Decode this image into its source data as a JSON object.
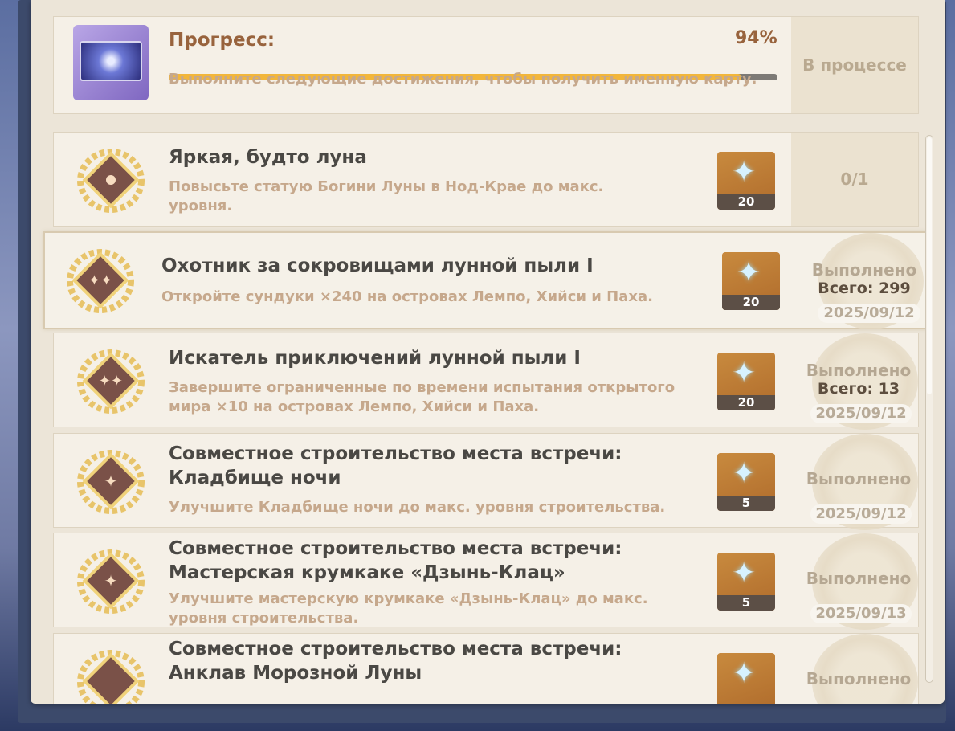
{
  "progress": {
    "title": "Прогресс:",
    "percent_text": "94%",
    "percent": 0.94,
    "description": "Выполните следующие достижения, чтобы получить именную карту.",
    "status": "В процессе"
  },
  "achievements": [
    {
      "title": "Яркая, будто луна",
      "description": "Повысьте статую Богини Луны в Нод-Крае до макс. уровня.",
      "reward": "20",
      "count": "0/1"
    },
    {
      "title": "Охотник за сокровищами лунной пыли I",
      "description": "Откройте сундуки ×240 на островах Лемпо, Хийси и Паха.",
      "reward": "20",
      "status": "Выполнено",
      "total": "Всего: 299",
      "date": "2025/09/12"
    },
    {
      "title": "Искатель приключений лунной пыли I",
      "description": "Завершите ограниченные по времени испытания открытого мира ×10 на островах Лемпо, Хийси и Паха.",
      "reward": "20",
      "status": "Выполнено",
      "total": "Всего: 13",
      "date": "2025/09/12"
    },
    {
      "title": "Совместное строительство места встречи: Кладбище ночи",
      "description": "Улучшите Кладбище ночи до макс. уровня строительства.",
      "reward": "5",
      "status": "Выполнено",
      "date": "2025/09/12"
    },
    {
      "title": "Совместное строительство места встречи: Мастерская крумкаке «Дзынь-Клац»",
      "description": "Улучшите мастерскую крумкаке «Дзынь-Клац» до макс. уровня строительства.",
      "reward": "5",
      "status": "Выполнено",
      "date": "2025/09/13"
    },
    {
      "title": "Совместное строительство места встречи: Анклав Морозной Луны",
      "status": "Выполнено"
    }
  ],
  "colors": {
    "accent": "#f2b63b",
    "brown": "#98633d"
  },
  "icons": {
    "reward": "primogem-icon",
    "badge": "achievement-badge-icon"
  }
}
